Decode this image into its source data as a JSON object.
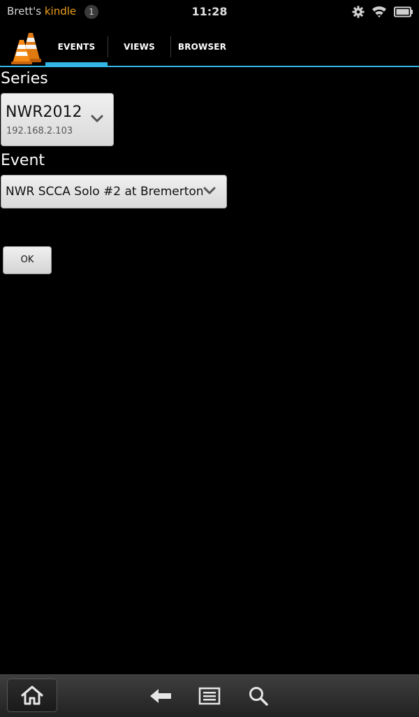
{
  "status_bar": {
    "owner": "Brett's",
    "device": "kindle",
    "notification_count": "1",
    "time": "11:28",
    "icons": [
      "gear-icon",
      "wifi-icon",
      "battery-icon"
    ]
  },
  "action_bar": {
    "logo": "traffic-cones-icon",
    "tabs": [
      {
        "label": "EVENTS",
        "selected": true
      },
      {
        "label": "VIEWS",
        "selected": false
      },
      {
        "label": "BROWSER",
        "selected": false
      }
    ],
    "accent_color": "#33b5e5"
  },
  "form": {
    "series_label": "Series",
    "series_value": "NWR2012",
    "series_subtext": "192.168.2.103",
    "event_label": "Event",
    "event_value": "NWR SCCA Solo #2 at Bremerton",
    "ok_label": "OK"
  },
  "nav_bar": {
    "buttons": [
      "home-icon",
      "back-arrow-icon",
      "menu-icon",
      "search-icon"
    ]
  }
}
